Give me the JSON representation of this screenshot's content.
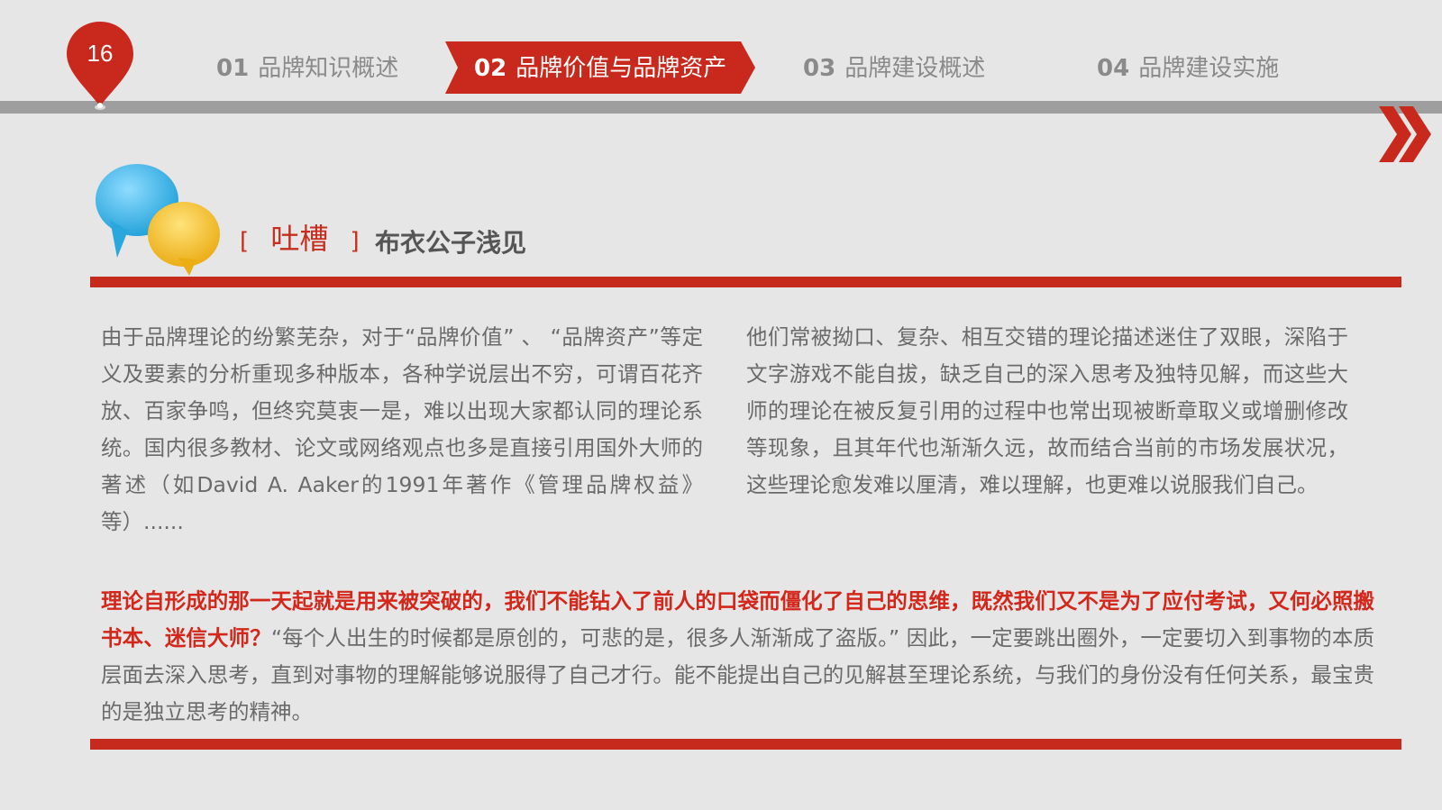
{
  "slide": {
    "page_number": "16"
  },
  "nav": {
    "tabs": [
      {
        "num": "01",
        "label": "品牌知识概述",
        "active": false
      },
      {
        "num": "02",
        "label": "品牌价值与品牌资产",
        "active": true
      },
      {
        "num": "03",
        "label": "品牌建设概述",
        "active": false
      },
      {
        "num": "04",
        "label": "品牌建设实施",
        "active": false
      }
    ]
  },
  "section": {
    "bracket_open": "[",
    "title": "吐槽",
    "bracket_close": "]",
    "author": "布衣公子浅见"
  },
  "body": {
    "left_paragraph": "由于品牌理论的纷繁芜杂，对于“品牌价值” 、 “品牌资产”等定义及要素的分析重现多种版本，各种学说层出不穷，可谓百花齐放、百家争鸣，但终究莫衷一是，难以出现大家都认同的理论系统。国内很多教材、论文或网络观点也多是直接引用国外大师的著述（如David A. Aaker的1991年著作《管理品牌权益》等）......",
    "right_paragraph": "他们常被拗口、复杂、相互交错的理论描述迷住了双眼，深陷于文字游戏不能自拔，缺乏自己的深入思考及独特见解，而这些大师的理论在被反复引用的过程中也常出现被断章取义或增删修改等现象，且其年代也渐渐久远，故而结合当前的市场发展状况，这些理论愈发难以厘清，难以理解，也更难以说服我们自己。",
    "highlight_text": "理论自形成的那一天起就是用来被突破的，我们不能钻入了前人的口袋而僵化了自己的思维，既然我们又不是为了应付考试，又何必照搬书本、迷信大师？",
    "closing_text": "“每个人出生的时候都是原创的，可悲的是，很多人渐渐成了盗版。” 因此，一定要跳出圈外，一定要切入到事物的本质层面去深入思考，直到对事物的理解能够说服得了自己才行。能不能提出自己的见解甚至理论系统，与我们的身份没有任何关系，最宝贵的是独立思考的精神。"
  },
  "colors": {
    "accent_red": "#c62a1d",
    "highlight_red": "#d3271b",
    "background": "#e6e6e6",
    "body_text": "#6a6a6a",
    "bubble_blue": "#3bb3e6",
    "bubble_yellow": "#f4be1f"
  },
  "icons": [
    "location-pin-icon",
    "double-chevron-right-icon",
    "speech-bubbles-icon"
  ]
}
